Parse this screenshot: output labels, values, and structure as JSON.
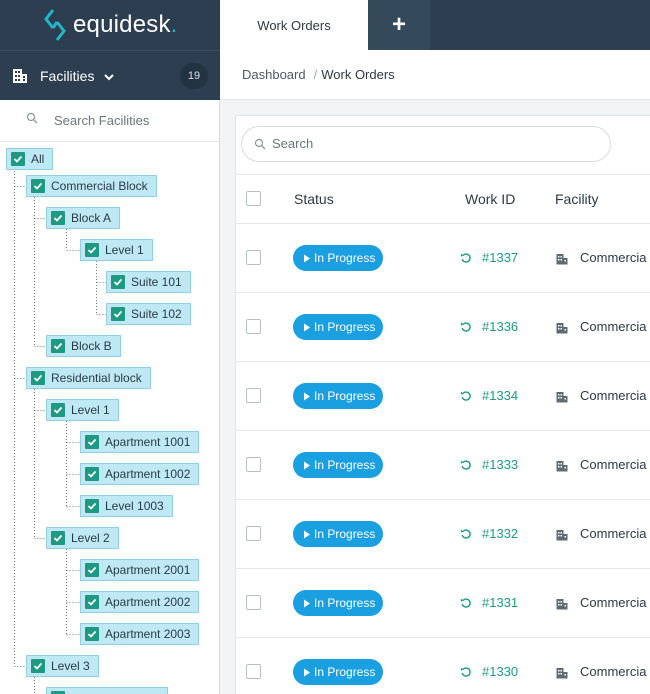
{
  "app": {
    "name": "equidesk",
    "logo_dot": "."
  },
  "tabs": {
    "active": "Work Orders",
    "add": "+"
  },
  "sidebar": {
    "title": "Facilities",
    "badge": "19",
    "search_placeholder": "Search Facilities",
    "tree": [
      {
        "label": "All"
      },
      {
        "label": "Commercial Block"
      },
      {
        "label": "Block A"
      },
      {
        "label": "Level 1"
      },
      {
        "label": "Suite 101"
      },
      {
        "label": "Suite 102"
      },
      {
        "label": "Block B"
      },
      {
        "label": "Residential block"
      },
      {
        "label": "Level 1"
      },
      {
        "label": "Apartment 1001"
      },
      {
        "label": "Apartment 1002"
      },
      {
        "label": "Level 1003"
      },
      {
        "label": "Level 2"
      },
      {
        "label": "Apartment 2001"
      },
      {
        "label": "Apartment 2002"
      },
      {
        "label": "Apartment 2003"
      },
      {
        "label": "Level 3"
      }
    ]
  },
  "breadcrumb": {
    "home": "Dashboard",
    "separator": "/",
    "current": "Work Orders"
  },
  "search": {
    "placeholder": "Search"
  },
  "table": {
    "columns": [
      "Status",
      "Work ID",
      "Facility"
    ],
    "rows": [
      {
        "status": "In Progress",
        "id": "#1337",
        "facility": "Commercia"
      },
      {
        "status": "In Progress",
        "id": "#1336",
        "facility": "Commercia"
      },
      {
        "status": "In Progress",
        "id": "#1334",
        "facility": "Commercia"
      },
      {
        "status": "In Progress",
        "id": "#1333",
        "facility": "Commercia"
      },
      {
        "status": "In Progress",
        "id": "#1332",
        "facility": "Commercia"
      },
      {
        "status": "In Progress",
        "id": "#1331",
        "facility": "Commercia"
      },
      {
        "status": "In Progress",
        "id": "#1330",
        "facility": "Commercia"
      }
    ]
  },
  "colors": {
    "topbar": "#2c3e4f",
    "accent_teal": "#21b6c9",
    "checkbox_green": "#1f9a82",
    "tree_highlight": "#bfe8f5",
    "status_blue": "#1a9fe0"
  },
  "icons": {
    "logo": "equidesk-logo-icon",
    "facilities": "building-icon",
    "chevron": "chevron-down-icon",
    "search": "search-icon",
    "check": "check-icon",
    "recurring": "recurring-icon",
    "facility": "building-icon"
  }
}
